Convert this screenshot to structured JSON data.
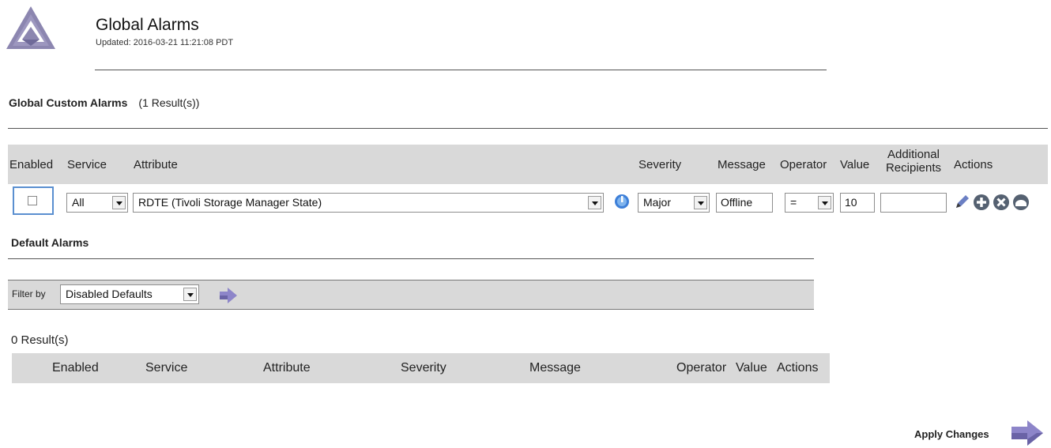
{
  "header": {
    "title": "Global Alarms",
    "updated": "Updated: 2016-03-21 11:21:08 PDT",
    "logo_icon": "triangle-logo-icon"
  },
  "custom_alarms": {
    "title": "Global Custom Alarms",
    "count": "(1 Result(s))",
    "columns": [
      "Enabled",
      "Service",
      "Attribute",
      "Severity",
      "Message",
      "Operator",
      "Value",
      "Additional Recipients",
      "Actions"
    ],
    "row": {
      "enabled": false,
      "service": "All",
      "attribute": "RDTE (Tivoli Storage Manager State)",
      "severity": "Major",
      "message": "Offline",
      "operator": "=",
      "value": "10",
      "additional_recipients": "",
      "action_icons": [
        "edit-pencil-icon",
        "add-row-icon",
        "delete-row-icon",
        "move-row-icon"
      ]
    }
  },
  "default_alarms": {
    "title": "Default Alarms",
    "filter_label": "Filter by",
    "filter_value": "Disabled Defaults",
    "result_count": "0 Result(s)",
    "columns": [
      "Enabled",
      "Service",
      "Attribute",
      "Severity",
      "Message",
      "Operator",
      "Value",
      "Actions"
    ]
  },
  "footer": {
    "apply_label": "Apply Changes"
  },
  "colors": {
    "band": "#d9d9d9",
    "logo": "#8c86b0",
    "icon_purple": "#6b7fc3",
    "icon_dark": "#556171",
    "focus_blue": "#5a8fd0"
  }
}
